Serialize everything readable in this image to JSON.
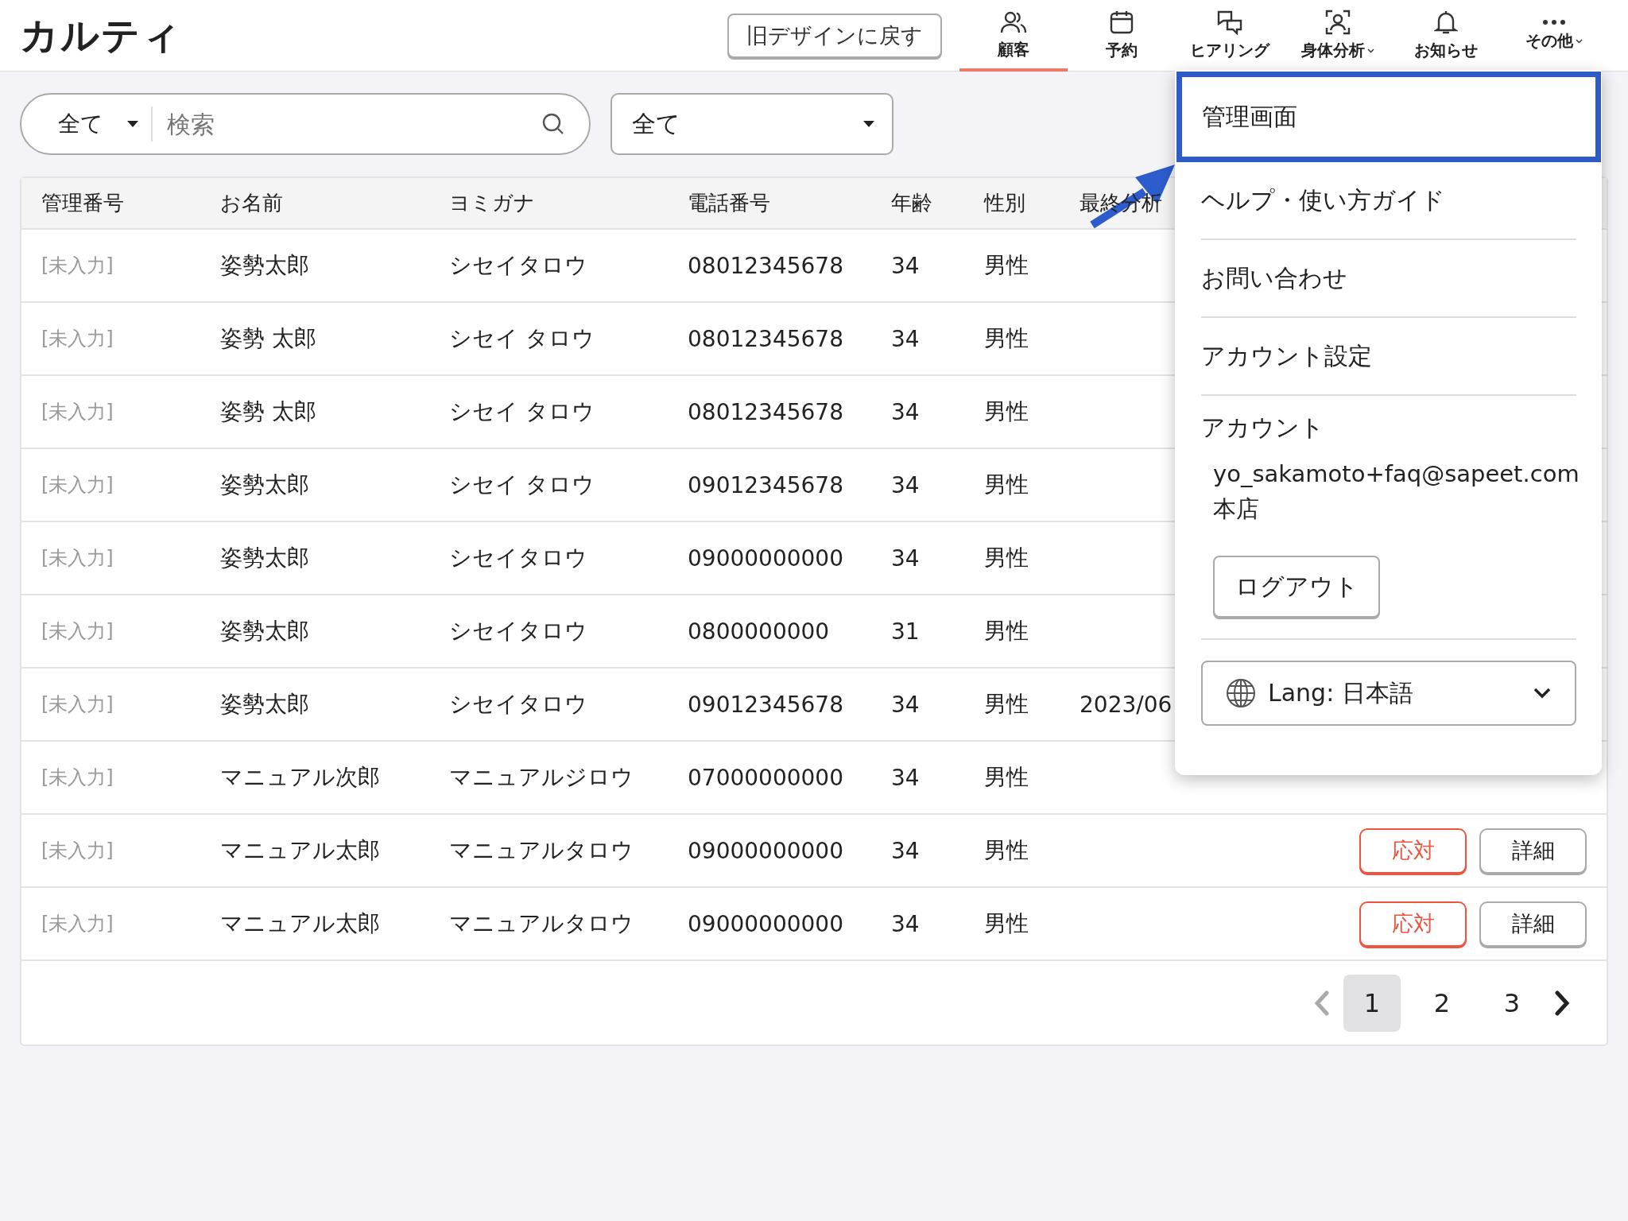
{
  "app": {
    "logo": "カルティ",
    "old_design_button": "旧デザインに戻す"
  },
  "nav": [
    {
      "kind": "people",
      "label": "顧客",
      "selected": true,
      "caret": false
    },
    {
      "kind": "calendar",
      "label": "予約",
      "selected": false,
      "caret": false
    },
    {
      "kind": "chat",
      "label": "ヒアリング",
      "selected": false,
      "caret": false
    },
    {
      "kind": "scan",
      "label": "身体分析",
      "selected": false,
      "caret": true
    },
    {
      "kind": "bell",
      "label": "お知らせ",
      "selected": false,
      "caret": false
    },
    {
      "kind": "dots",
      "label": "その他",
      "selected": false,
      "caret": true
    }
  ],
  "filters": {
    "scope": "全て",
    "search": {
      "placeholder": "検索"
    },
    "status": "全て"
  },
  "table": {
    "columns": [
      "管理番号",
      "お名前",
      "ヨミガナ",
      "電話番号",
      "年齢",
      "性別",
      "最終分析"
    ],
    "rows": [
      {
        "id": "[未入力]",
        "name": "姿勢太郎",
        "kana": "シセイタロウ",
        "phone": "08012345678",
        "age": "34",
        "sex": "男性"
      },
      {
        "id": "[未入力]",
        "name": "姿勢 太郎",
        "kana": "シセイ タロウ",
        "phone": "08012345678",
        "age": "34",
        "sex": "男性"
      },
      {
        "id": "[未入力]",
        "name": "姿勢 太郎",
        "kana": "シセイ タロウ",
        "phone": "08012345678",
        "age": "34",
        "sex": "男性"
      },
      {
        "id": "[未入力]",
        "name": "姿勢太郎",
        "kana": "シセイ タロウ",
        "phone": "09012345678",
        "age": "34",
        "sex": "男性"
      },
      {
        "id": "[未入力]",
        "name": "姿勢太郎",
        "kana": "シセイタロウ",
        "phone": "09000000000",
        "age": "34",
        "sex": "男性"
      },
      {
        "id": "[未入力]",
        "name": "姿勢太郎",
        "kana": "シセイタロウ",
        "phone": "0800000000",
        "age": "31",
        "sex": "男性"
      },
      {
        "id": "[未入力]",
        "name": "姿勢太郎",
        "kana": "シセイタロウ",
        "phone": "09012345678",
        "age": "34",
        "sex": "男性",
        "date": "2023/06"
      },
      {
        "id": "[未入力]",
        "name": "マニュアル次郎",
        "kana": "マニュアルジロウ",
        "phone": "07000000000",
        "age": "34",
        "sex": "男性"
      },
      {
        "id": "[未入力]",
        "name": "マニュアル太郎",
        "kana": "マニュアルタロウ",
        "phone": "09000000000",
        "age": "34",
        "sex": "男性",
        "actions": [
          "応対",
          "詳細"
        ]
      },
      {
        "id": "[未入力]",
        "name": "マニュアル太郎",
        "kana": "マニュアルタロウ",
        "phone": "09000000000",
        "age": "34",
        "sex": "男性",
        "actions": [
          "応対",
          "詳細"
        ]
      }
    ]
  },
  "pagination": {
    "pages": [
      {
        "label": "1",
        "selected": true
      },
      {
        "label": "2",
        "selected": false
      },
      {
        "label": "3",
        "selected": false
      }
    ]
  },
  "menu": {
    "items": [
      {
        "label": "管理画面",
        "selected": true
      },
      {
        "label": "ヘルプ・使い方ガイド",
        "selected": false
      },
      {
        "label": "お問い合わせ",
        "selected": false
      },
      {
        "label": "アカウント設定",
        "selected": false
      }
    ],
    "account_label": "アカウント",
    "email": "yo_sakamoto+faq@sapeet.com",
    "store": "本店",
    "logout": "ログアウト",
    "language": "Lang: 日本語"
  }
}
